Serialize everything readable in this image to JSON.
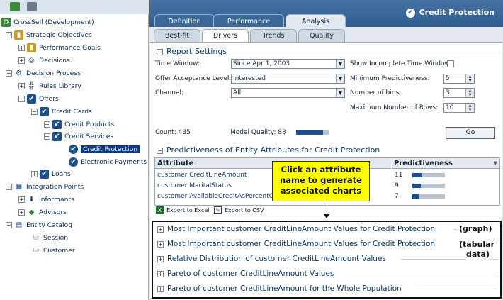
{
  "colors": {
    "header": "#2f5d8f",
    "selected": "#0a3a86",
    "callout": "#ffff00"
  },
  "tree": {
    "root": "CrossSell (Development)",
    "items": [
      {
        "label": "Strategic Objectives",
        "icon": "bar-chart-icon"
      },
      {
        "label": "Performance Goals",
        "icon": "bar-chart-icon"
      },
      {
        "label": "Decisions",
        "icon": "target-icon"
      },
      {
        "label": "Decision Process",
        "icon": "gear-icon"
      },
      {
        "label": "Rules Library",
        "icon": "hierarchy-icon"
      },
      {
        "label": "Offers",
        "icon": "checked-folder-icon"
      },
      {
        "label": "Credit Cards",
        "icon": "checked-folder-icon"
      },
      {
        "label": "Credit Products",
        "icon": "checked-folder-icon"
      },
      {
        "label": "Credit Services",
        "icon": "checked-folder-icon"
      },
      {
        "label": "Credit Protection",
        "icon": "check-circle-icon"
      },
      {
        "label": "Electronic Payments",
        "icon": "check-circle-icon"
      },
      {
        "label": "Loans",
        "icon": "checked-folder-icon"
      },
      {
        "label": "Integration Points",
        "icon": "grid-icon"
      },
      {
        "label": "Informants",
        "icon": "down-arrow-icon"
      },
      {
        "label": "Advisors",
        "icon": "diamond-icon"
      },
      {
        "label": "Entity Catalog",
        "icon": "database-icon"
      },
      {
        "label": "Session",
        "icon": "cylinder-icon"
      },
      {
        "label": "Customer",
        "icon": "cylinder-icon"
      }
    ]
  },
  "header": {
    "title": "Credit Protection"
  },
  "tabs": [
    "Definition",
    "Performance",
    "Analysis"
  ],
  "subtabs": [
    "Best-fit",
    "Drivers",
    "Trends",
    "Quality"
  ],
  "report": {
    "title": "Report Settings",
    "time_window_label": "Time Window:",
    "time_window": "Since Apr 1, 2003",
    "acceptance_label": "Offer Acceptance Level:",
    "acceptance": "Interested",
    "channel_label": "Channel:",
    "channel": "All",
    "show_incomplete_label": "Show Incomplete Time Window:",
    "min_pred_label": "Minimum Predictiveness:",
    "min_pred": "5",
    "bins_label": "Number of bins:",
    "bins": "3",
    "max_rows_label": "Maximum Number of Rows:",
    "max_rows": "10",
    "count": "Count: 435",
    "quality": "Model Quality: 83",
    "quality_level": 0.83,
    "go": "Go"
  },
  "pred": {
    "title": "Predictiveness of Entity Attributes for Credit Protection",
    "col_attr": "Attribute",
    "col_pred": "Predictiveness",
    "rows": [
      {
        "attr": "customer CreditLineAmount",
        "value": "11",
        "level": 0.3
      },
      {
        "attr": "customer MaritalStatus",
        "value": "9",
        "level": 0.25
      },
      {
        "attr": "customer AvailableCreditAsPercentOf",
        "value": "7",
        "level": 0.19
      }
    ],
    "export_excel": "Export to Excel",
    "export_csv": "Export to CSV"
  },
  "callout": {
    "line1": "Click an attribute",
    "line2": "name to generate",
    "line3": "associated charts"
  },
  "sections": [
    "Most Important customer CreditLineAmount Values for Credit Protection",
    "Most Important customer CreditLineAmount Values for Credit Protection",
    "Relative Distribution of customer CreditLineAmount Values",
    "Pareto of customer CreditLineAmount Values",
    "Pareto of customer CreditLineAmount for the Whole Population"
  ],
  "notes": {
    "graph": "(graph)",
    "tab1": "(tabular",
    "tab2": "data)"
  }
}
